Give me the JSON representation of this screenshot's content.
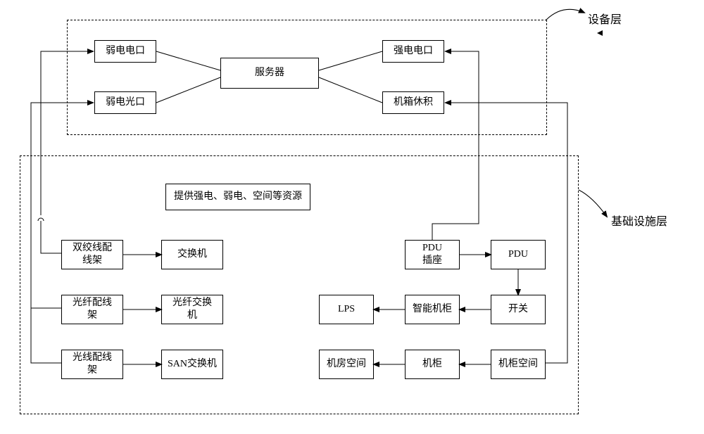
{
  "layers": {
    "device": "设备层",
    "infra": "基础设施层"
  },
  "top": {
    "weak_e": "弱电电口",
    "weak_o": "弱电光口",
    "server": "服务器",
    "strong_e": "强电电口",
    "chassis": "机箱休积"
  },
  "infra_caption": "提供强电、弱电、空间等资源",
  "left": {
    "twisted": "双绞线配\n线架",
    "switch": "交换机",
    "fiber_patch": "光纤配线\n架",
    "fiber_switch": "光纤交换\n机",
    "optical_patch": "光线配线\n架",
    "san": "SAN交换机"
  },
  "right": {
    "pdu_socket": "PDU\n插座",
    "pdu": "PDU",
    "lps": "LPS",
    "smart_cab": "智能机柜",
    "switch2": "开关",
    "room_space": "机房空间",
    "cabinet": "机柜",
    "cab_space": "机柜空间"
  }
}
